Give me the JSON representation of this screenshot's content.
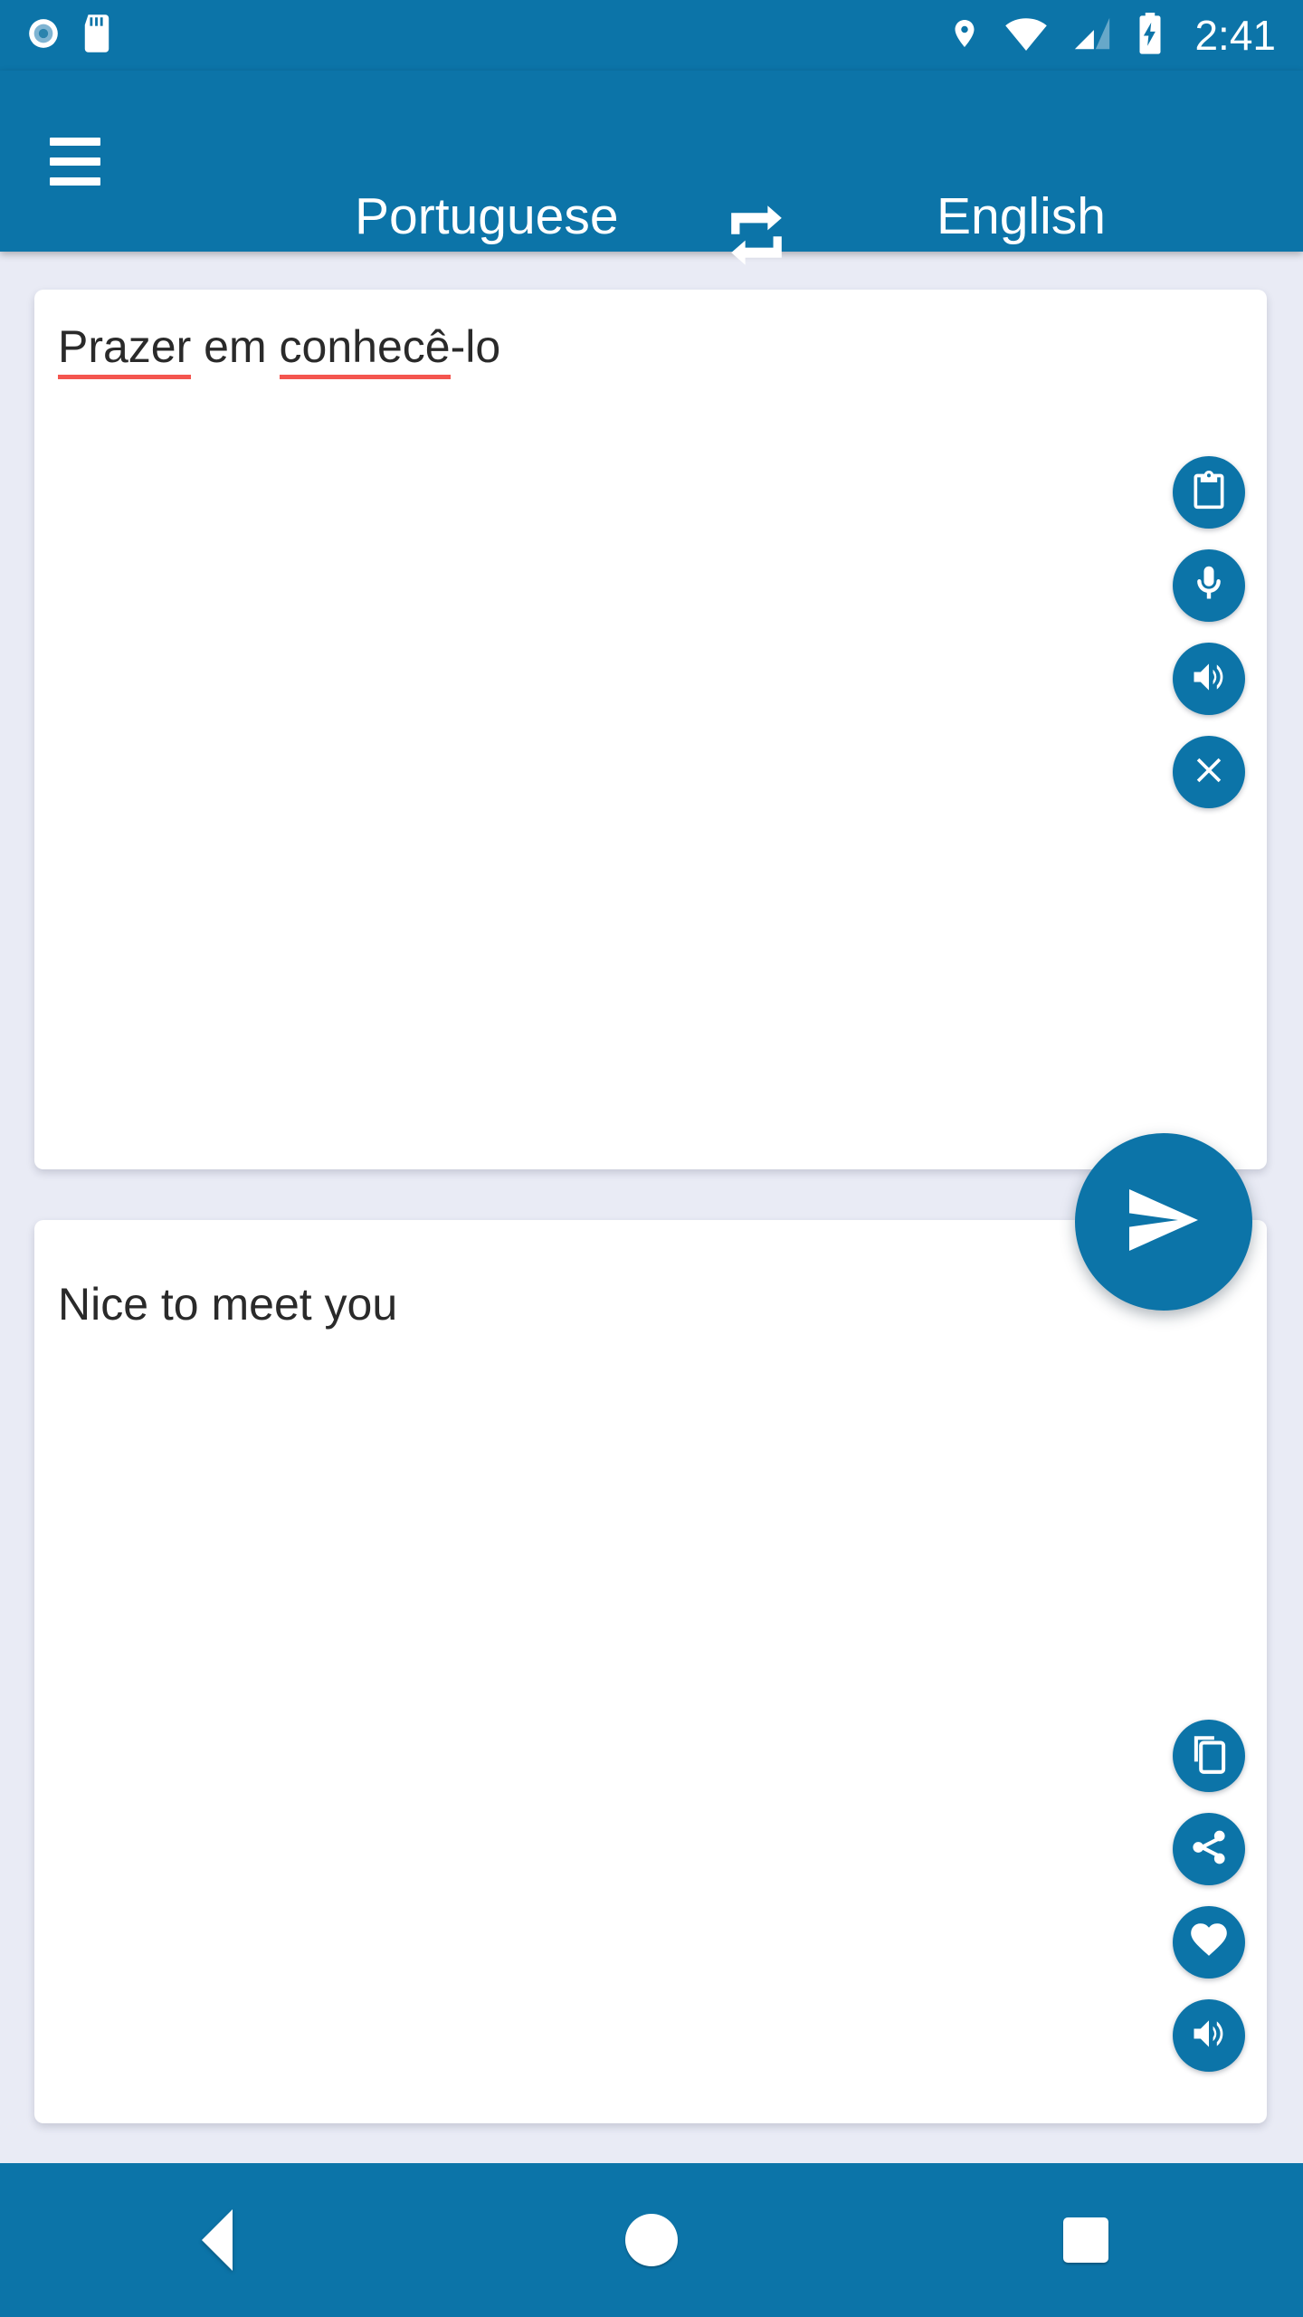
{
  "theme": {
    "primary": "#0c74a8",
    "page_background": "#e9ebf5",
    "card_background": "#ffffff",
    "spellcheck_underline": "#f4554f",
    "on_primary": "#ffffff"
  },
  "status_bar": {
    "time": "2:41",
    "left_icons": [
      {
        "name": "screen-record-icon",
        "label": "screen recording"
      },
      {
        "name": "sd-card-icon",
        "label": "sd card"
      }
    ],
    "right_icons": [
      {
        "name": "location-icon",
        "label": "location"
      },
      {
        "name": "wifi-icon",
        "label": "wifi"
      },
      {
        "name": "cellular-signal-icon",
        "label": "signal"
      },
      {
        "name": "battery-charging-icon",
        "label": "battery charging"
      }
    ]
  },
  "app_bar": {
    "menu_icon": "hamburger-menu-icon",
    "source_language": "Portuguese",
    "swap_icon": "swap-languages-icon",
    "target_language": "English"
  },
  "input_card": {
    "text": "Prazer em conhecê-lo",
    "segments": [
      {
        "text": "Prazer",
        "misspelled": true
      },
      {
        "text": " em ",
        "misspelled": false
      },
      {
        "text": "conhecê",
        "misspelled": true
      },
      {
        "text": "-lo",
        "misspelled": false
      }
    ],
    "actions": [
      {
        "name": "paste-button",
        "icon": "clipboard-icon",
        "label": "Paste"
      },
      {
        "name": "voice-input-button",
        "icon": "microphone-icon",
        "label": "Speak"
      },
      {
        "name": "speak-source-button",
        "icon": "volume-up-icon",
        "label": "Listen"
      },
      {
        "name": "clear-button",
        "icon": "close-icon",
        "label": "Clear"
      }
    ]
  },
  "translate_button": {
    "name": "send-button",
    "icon": "send-icon",
    "label": "Translate"
  },
  "output_card": {
    "text": "Nice to meet you",
    "actions": [
      {
        "name": "copy-button",
        "icon": "copy-icon",
        "label": "Copy"
      },
      {
        "name": "share-button",
        "icon": "share-icon",
        "label": "Share"
      },
      {
        "name": "favorite-button",
        "icon": "heart-icon",
        "label": "Favorite"
      },
      {
        "name": "speak-target-button",
        "icon": "volume-up-icon",
        "label": "Listen"
      }
    ]
  },
  "nav_bar": {
    "buttons": [
      {
        "name": "nav-back-button",
        "icon": "triangle-back-icon",
        "label": "Back"
      },
      {
        "name": "nav-home-button",
        "icon": "circle-home-icon",
        "label": "Home"
      },
      {
        "name": "nav-recents-button",
        "icon": "square-recents-icon",
        "label": "Recents"
      }
    ]
  }
}
